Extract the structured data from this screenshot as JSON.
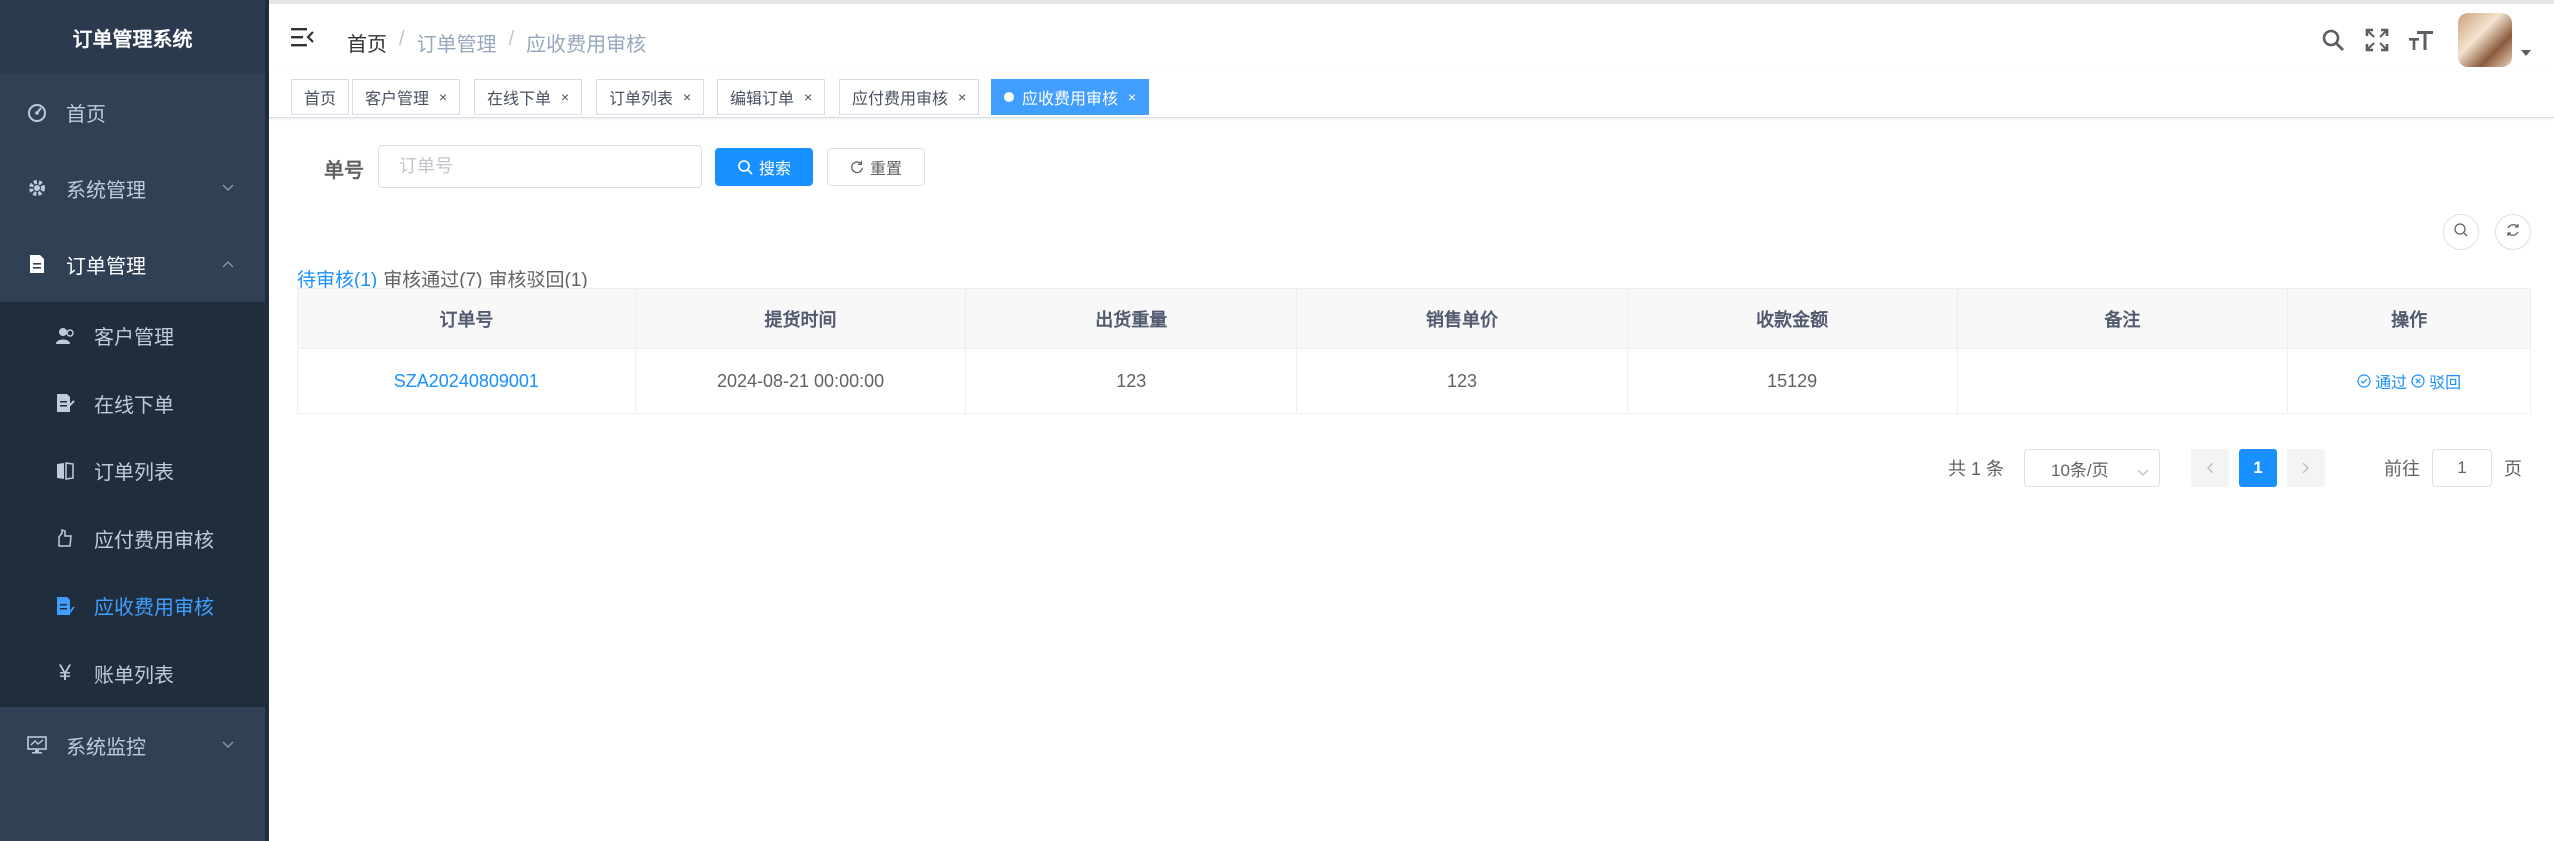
{
  "sidebar": {
    "title": "订单管理系统",
    "items": [
      {
        "label": "首页",
        "icon": "dashboard-icon"
      },
      {
        "label": "系统管理",
        "icon": "gear-icon"
      },
      {
        "label": "订单管理",
        "icon": "document-icon"
      }
    ],
    "submenu": [
      {
        "label": "客户管理",
        "icon": "user-icon"
      },
      {
        "label": "在线下单",
        "icon": "edit-doc-icon"
      },
      {
        "label": "订单列表",
        "icon": "book-icon"
      },
      {
        "label": "应付费用审核",
        "icon": "hand-icon"
      },
      {
        "label": "应收费用审核",
        "icon": "doc-check-icon"
      },
      {
        "label": "账单列表",
        "icon": "yen-icon"
      }
    ],
    "bottom_item": {
      "label": "系统监控",
      "icon": "monitor-icon"
    }
  },
  "breadcrumb": {
    "home": "首页",
    "sep": "/",
    "mid": "订单管理",
    "current": "应收费用审核"
  },
  "tags": [
    {
      "label": "首页"
    },
    {
      "label": "客户管理"
    },
    {
      "label": "在线下单"
    },
    {
      "label": "订单列表"
    },
    {
      "label": "编辑订单"
    },
    {
      "label": "应付费用审核"
    },
    {
      "label": "应收费用审核"
    }
  ],
  "search": {
    "label": "单号",
    "placeholder": "订单号",
    "search_button": "搜索",
    "reset_button": "重置"
  },
  "status_tabs": {
    "pending": "待审核(1)",
    "approved": "审核通过(7)",
    "rejected": "审核驳回(1)"
  },
  "table": {
    "headers": [
      "订单号",
      "提货时间",
      "出货重量",
      "销售单价",
      "收款金额",
      "备注",
      "操作"
    ],
    "rows": [
      {
        "order_no": "SZA20240809001",
        "pickup_time": "2024-08-21 00:00:00",
        "weight": "123",
        "price": "123",
        "amount": "15129",
        "note": "",
        "approve": "通过",
        "reject": "驳回"
      }
    ]
  },
  "pagination": {
    "total": "共 1 条",
    "page_size": "10条/页",
    "current_page": "1",
    "goto_label": "前往",
    "goto_value": "1",
    "page_unit": "页"
  },
  "colors": {
    "sidebar_bg": "#304156",
    "primary": "#1890ff",
    "active_menu": "#409eff"
  }
}
